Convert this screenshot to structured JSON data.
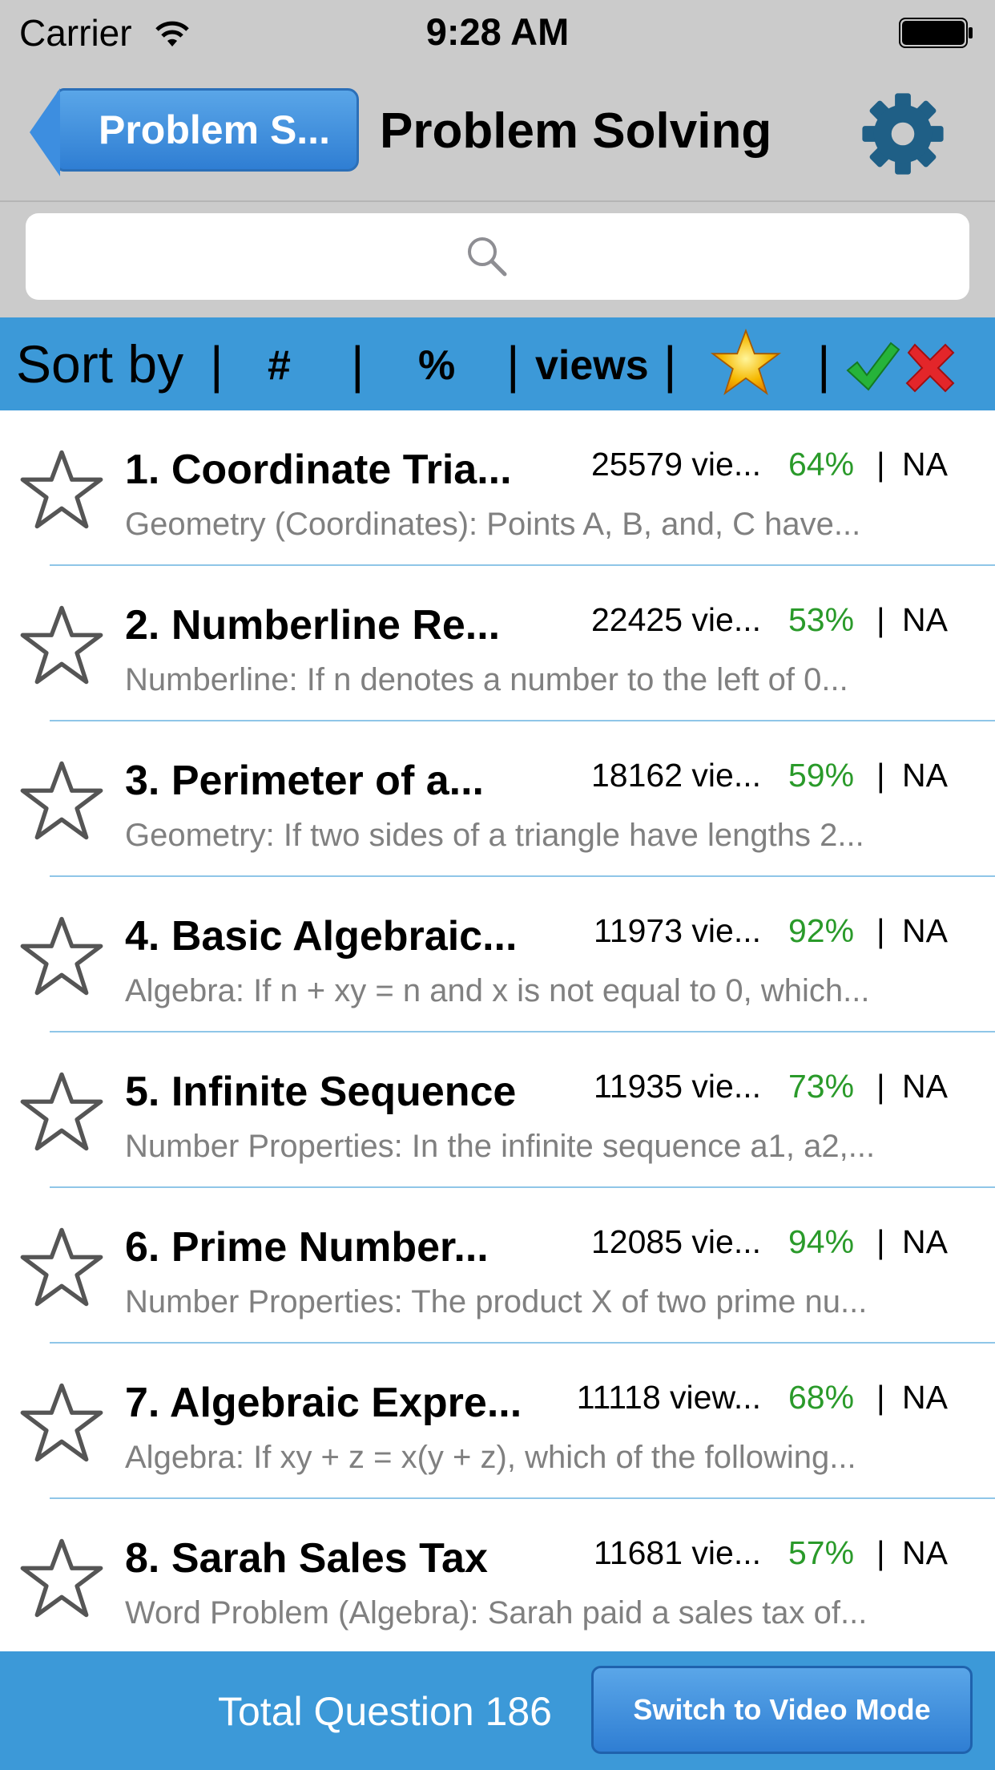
{
  "status_bar": {
    "carrier": "Carrier",
    "time": "9:28 AM"
  },
  "navbar": {
    "back_label": "Problem S...",
    "title": "Problem Solving"
  },
  "search": {
    "placeholder": ""
  },
  "sortbar": {
    "label": "Sort by",
    "options": [
      "#",
      "%",
      "views"
    ],
    "pipe": "|"
  },
  "colors": {
    "accent": "#3c99d8",
    "percent_green": "#2a9a2a",
    "bar_gray": "#cbcbcb"
  },
  "questions": [
    {
      "title": "1. Coordinate Tria...",
      "views": "25579 vie...",
      "percent": "64%",
      "sep": "|",
      "status": "NA",
      "description": "Geometry (Coordinates): Points A, B, and, C have..."
    },
    {
      "title": "2. Numberline Re...",
      "views": "22425 vie...",
      "percent": "53%",
      "sep": "|",
      "status": "NA",
      "description": "Numberline: If n denotes a number to the left of 0..."
    },
    {
      "title": "3. Perimeter of a...",
      "views": "18162 vie...",
      "percent": "59%",
      "sep": "|",
      "status": "NA",
      "description": "Geometry: If two sides of a triangle have lengths 2..."
    },
    {
      "title": "4. Basic Algebraic...",
      "views": "11973 vie...",
      "percent": "92%",
      "sep": "|",
      "status": "NA",
      "description": "Algebra: If n + xy = n and x is not equal to 0, which..."
    },
    {
      "title": "5. Infinite Sequence",
      "views": "11935 vie...",
      "percent": "73%",
      "sep": "|",
      "status": "NA",
      "description": "Number Properties: In the infinite sequence a1, a2,..."
    },
    {
      "title": "6. Prime Number...",
      "views": "12085 vie...",
      "percent": "94%",
      "sep": "|",
      "status": "NA",
      "description": "Number Properties: The product X of two prime nu..."
    },
    {
      "title": "7. Algebraic Expre...",
      "views": "11118 view...",
      "percent": "68%",
      "sep": "|",
      "status": "NA",
      "description": "Algebra: If xy + z = x(y + z), which of the following..."
    },
    {
      "title": "8. Sarah Sales Tax",
      "views": "11681 vie...",
      "percent": "57%",
      "sep": "|",
      "status": "NA",
      "description": "Word Problem (Algebra): Sarah paid a sales tax of..."
    }
  ],
  "footer": {
    "total": "Total Question 186",
    "switch_label": "Switch to Video Mode"
  }
}
